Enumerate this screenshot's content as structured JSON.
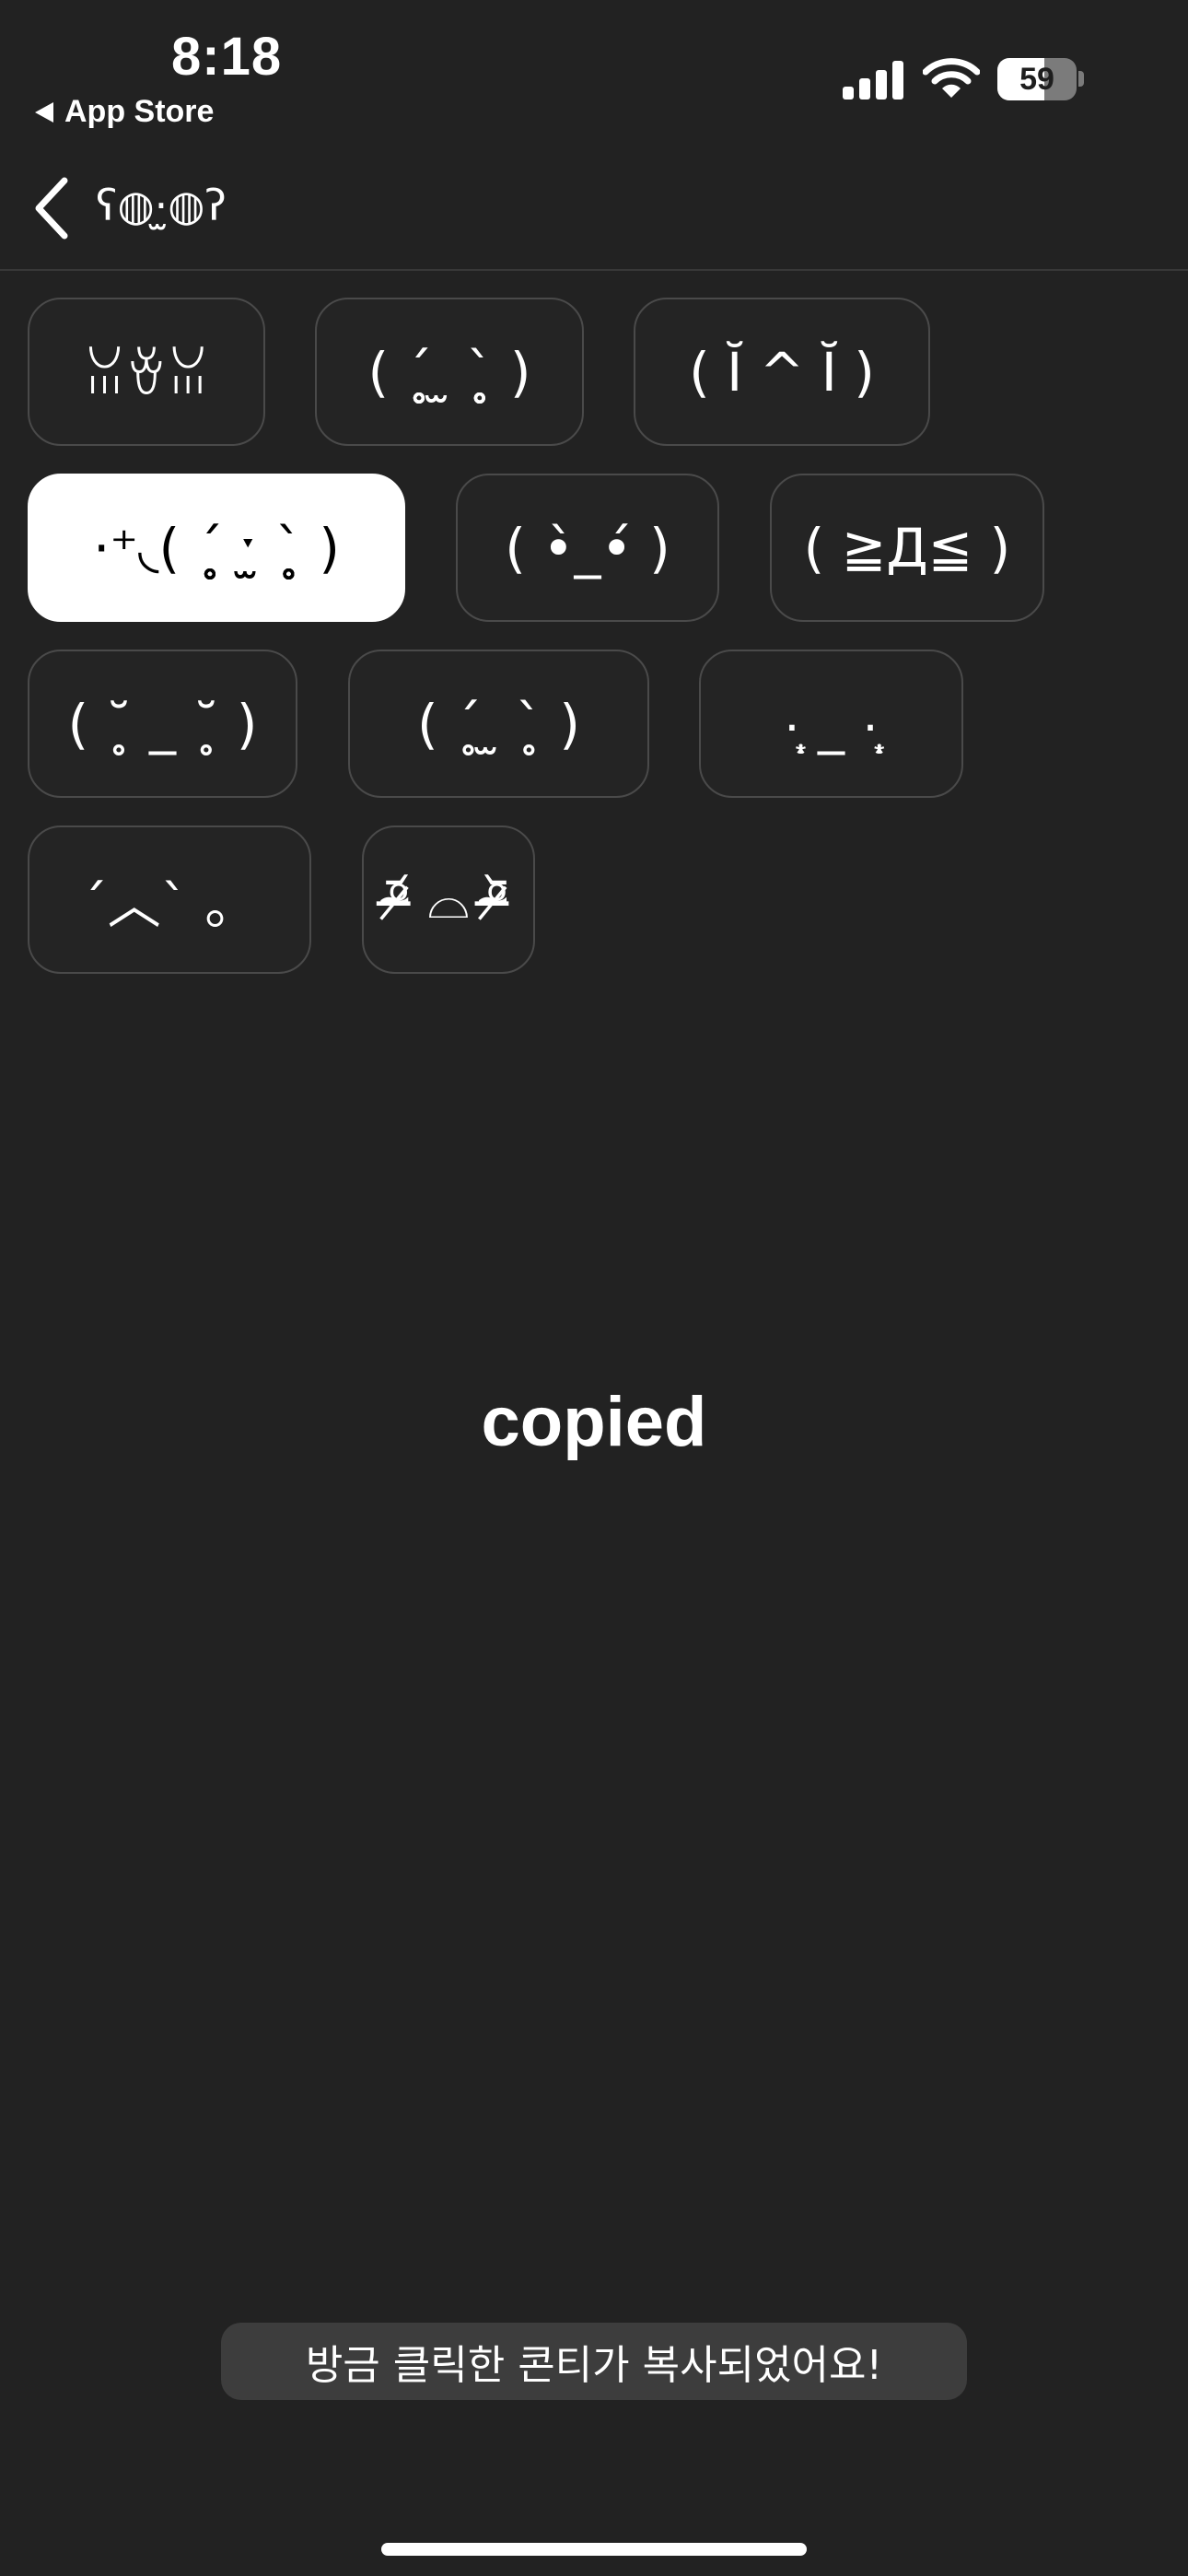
{
  "status_bar": {
    "time": "8:18",
    "back_label": "App Store",
    "battery_percent": "59",
    "battery_level": 0.59
  },
  "nav": {
    "title": "ʕ◍·̫◍ʔ"
  },
  "emoticons": [
    "ꈍꈊꈍ",
    "( ˊ̥̥̥̥̥ ̫ ˋ̥̥̥̥̥ )",
    "( Ĭ ^ Ĭ )",
    "·⁺◟( ˊ̥̥̥̥̥ ˑ̫ ˋ̥̥̥̥̥ )",
    "( •̀_•́ )",
    "( ≧Д≦ )",
    "( ˘̥ _ ˘̥ )",
    "( ˊ̥ ̫ ˋ̥ )",
    "·̩͙ _ ·̩͙",
    "ˊ︿ˋ 。",
    "ᵒ̴̶̷᷄ ⌓ ᵒ̴̶̷᷅"
  ],
  "selected_index": 3,
  "main": {
    "copied_label": "copied"
  },
  "toast": {
    "message": "방금 클릭한 콘티가 복사되었어요!"
  },
  "colors": {
    "background": "#222222",
    "chip_border": "#4a4a4a",
    "selected_chip": "#ffffff",
    "toast_background": "#3d3d3d"
  }
}
